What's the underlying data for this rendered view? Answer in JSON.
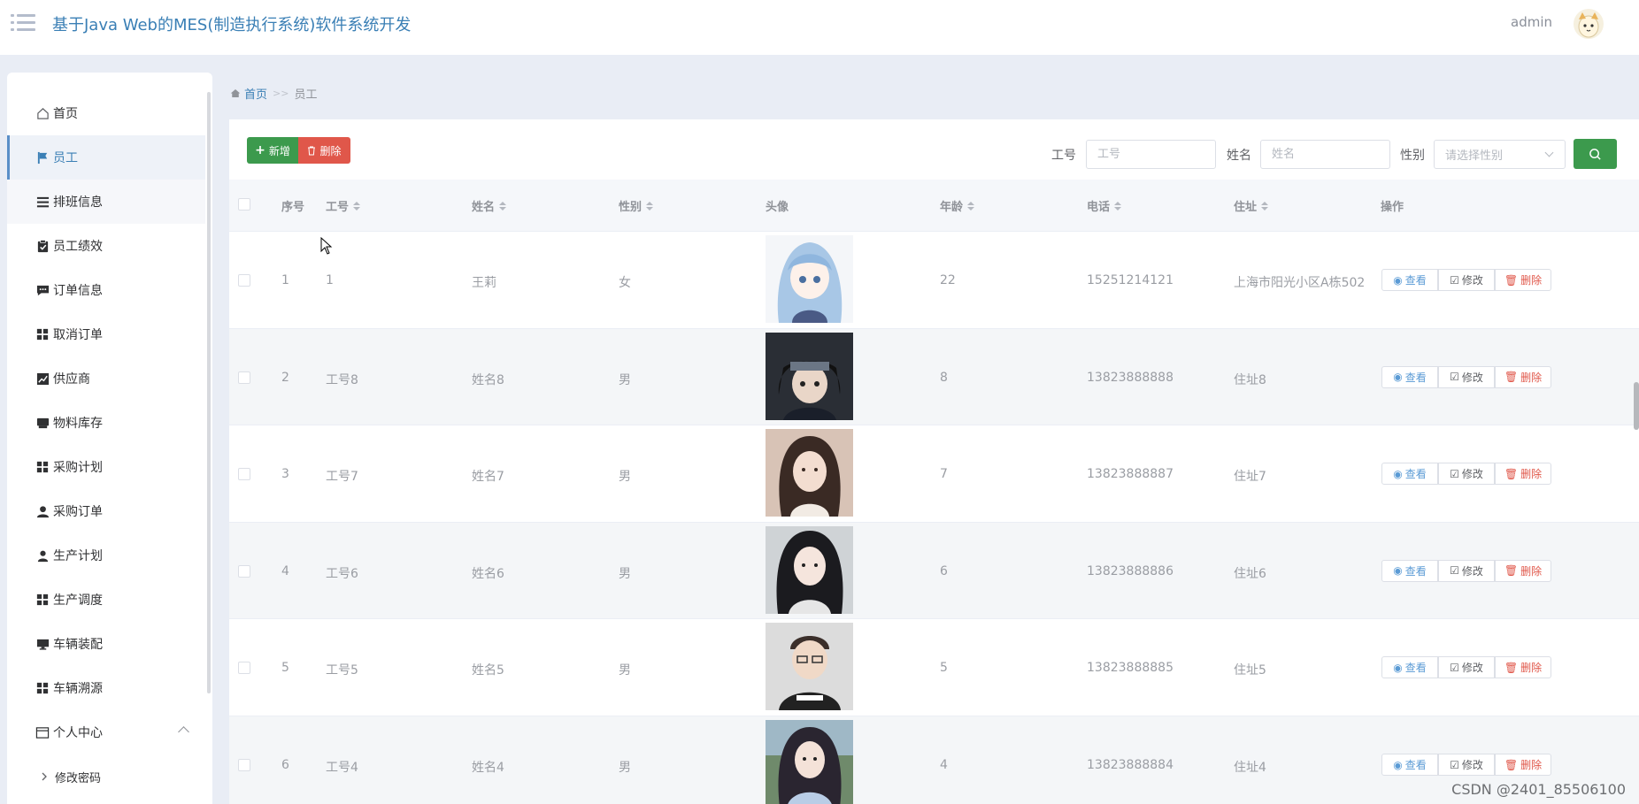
{
  "header": {
    "title": "基于Java Web的MES(制造执行系统)软件系统开发",
    "username": "admin"
  },
  "sidebar": {
    "items": [
      {
        "label": "首页",
        "icon": "home-icon"
      },
      {
        "label": "员工",
        "icon": "flag-icon"
      },
      {
        "label": "排班信息",
        "icon": "list-icon"
      },
      {
        "label": "员工绩效",
        "icon": "clipboard-check-icon"
      },
      {
        "label": "订单信息",
        "icon": "comment-icon"
      },
      {
        "label": "取消订单",
        "icon": "grid-icon"
      },
      {
        "label": "供应商",
        "icon": "chart-line-icon"
      },
      {
        "label": "物料库存",
        "icon": "box-icon"
      },
      {
        "label": "采购计划",
        "icon": "grid-icon"
      },
      {
        "label": "采购订单",
        "icon": "user-icon"
      },
      {
        "label": "生产计划",
        "icon": "user-icon"
      },
      {
        "label": "生产调度",
        "icon": "grid-icon"
      },
      {
        "label": "车辆装配",
        "icon": "monitor-icon"
      },
      {
        "label": "车辆溯源",
        "icon": "grid-icon"
      },
      {
        "label": "个人中心",
        "icon": "window-icon"
      },
      {
        "label": "修改密码",
        "icon": "chevron-right-icon"
      }
    ]
  },
  "breadcrumb": {
    "home": "首页",
    "separator": ">>",
    "current": "员工"
  },
  "toolbar": {
    "add_label": "新增",
    "delete_label": "删除"
  },
  "filters": {
    "emp_no_label": "工号",
    "emp_no_placeholder": "工号",
    "name_label": "姓名",
    "name_placeholder": "姓名",
    "gender_label": "性别",
    "gender_placeholder": "请选择性别"
  },
  "table": {
    "headers": {
      "index": "序号",
      "emp_no": "工号",
      "name": "姓名",
      "gender": "性别",
      "photo": "头像",
      "age": "年龄",
      "phone": "电话",
      "address": "住址",
      "actions": "操作"
    },
    "rows": [
      {
        "index": "1",
        "emp_no": "1",
        "name": "王莉",
        "gender": "女",
        "age": "22",
        "phone": "15251214121",
        "address": "上海市阳光小区A栋502"
      },
      {
        "index": "2",
        "emp_no": "工号8",
        "name": "姓名8",
        "gender": "男",
        "age": "8",
        "phone": "13823888888",
        "address": "住址8"
      },
      {
        "index": "3",
        "emp_no": "工号7",
        "name": "姓名7",
        "gender": "男",
        "age": "7",
        "phone": "13823888887",
        "address": "住址7"
      },
      {
        "index": "4",
        "emp_no": "工号6",
        "name": "姓名6",
        "gender": "男",
        "age": "6",
        "phone": "13823888886",
        "address": "住址6"
      },
      {
        "index": "5",
        "emp_no": "工号5",
        "name": "姓名5",
        "gender": "男",
        "age": "5",
        "phone": "13823888885",
        "address": "住址5"
      },
      {
        "index": "6",
        "emp_no": "工号4",
        "name": "姓名4",
        "gender": "男",
        "age": "4",
        "phone": "13823888884",
        "address": "住址4"
      }
    ],
    "actions": {
      "view": "查看",
      "edit": "修改",
      "delete": "删除"
    }
  },
  "watermark": "CSDN @2401_85506100",
  "colors": {
    "primary_green": "#3c9a4d",
    "danger_red": "#e0574a",
    "link_blue": "#3a7fb5",
    "view_blue": "#5b9bd5"
  }
}
